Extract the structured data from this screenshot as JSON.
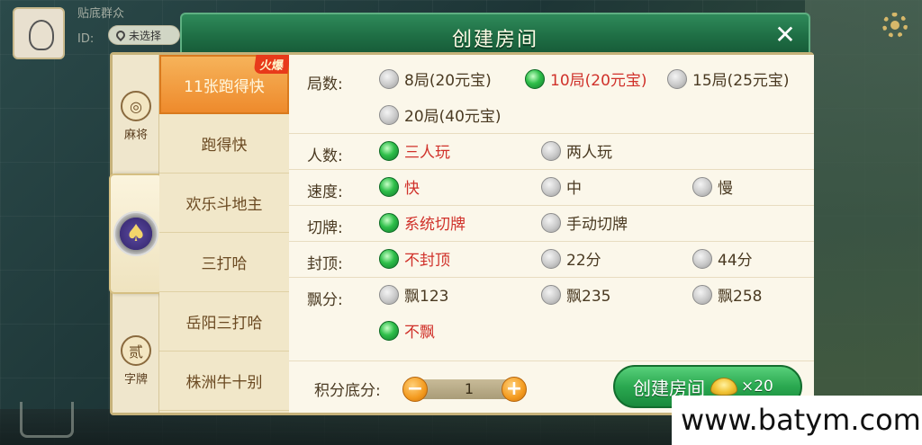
{
  "background": {
    "player_name": "贴底群众",
    "player_id": "ID:",
    "location": "未选择"
  },
  "dialog": {
    "title": "创建房间",
    "close": "✕"
  },
  "categories": [
    {
      "label": "麻将",
      "glyph": "◎"
    },
    {
      "label": "",
      "glyph": "♠"
    },
    {
      "label": "字牌",
      "glyph": "贰"
    }
  ],
  "games": [
    {
      "label": "11张跑得快",
      "badge": "火爆",
      "active": true
    },
    {
      "label": "跑得快"
    },
    {
      "label": "欢乐斗地主"
    },
    {
      "label": "三打哈"
    },
    {
      "label": "岳阳三打哈"
    },
    {
      "label": "株洲牛十别"
    }
  ],
  "options": {
    "rounds": {
      "label": "局数:",
      "choices": [
        "8局(20元宝)",
        "10局(20元宝)",
        "15局(25元宝)",
        "20局(40元宝)"
      ],
      "selected": "10局(20元宝)"
    },
    "players": {
      "label": "人数:",
      "choices": [
        "三人玩",
        "两人玩"
      ],
      "selected": "三人玩"
    },
    "speed": {
      "label": "速度:",
      "choices": [
        "快",
        "中",
        "慢"
      ],
      "selected": "快"
    },
    "cut": {
      "label": "切牌:",
      "choices": [
        "系统切牌",
        "手动切牌"
      ],
      "selected": "系统切牌"
    },
    "cap": {
      "label": "封顶:",
      "choices": [
        "不封顶",
        "22分",
        "44分"
      ],
      "selected": "不封顶"
    },
    "float": {
      "label": "飘分:",
      "choices": [
        "飘123",
        "飘235",
        "飘258",
        "不飘"
      ],
      "selected": "不飘"
    }
  },
  "score": {
    "label": "积分底分:",
    "value": "1",
    "minus": "−",
    "plus": "+"
  },
  "create": {
    "label": "创建房间",
    "cost": "×20"
  },
  "watermark": "www.batym.com"
}
